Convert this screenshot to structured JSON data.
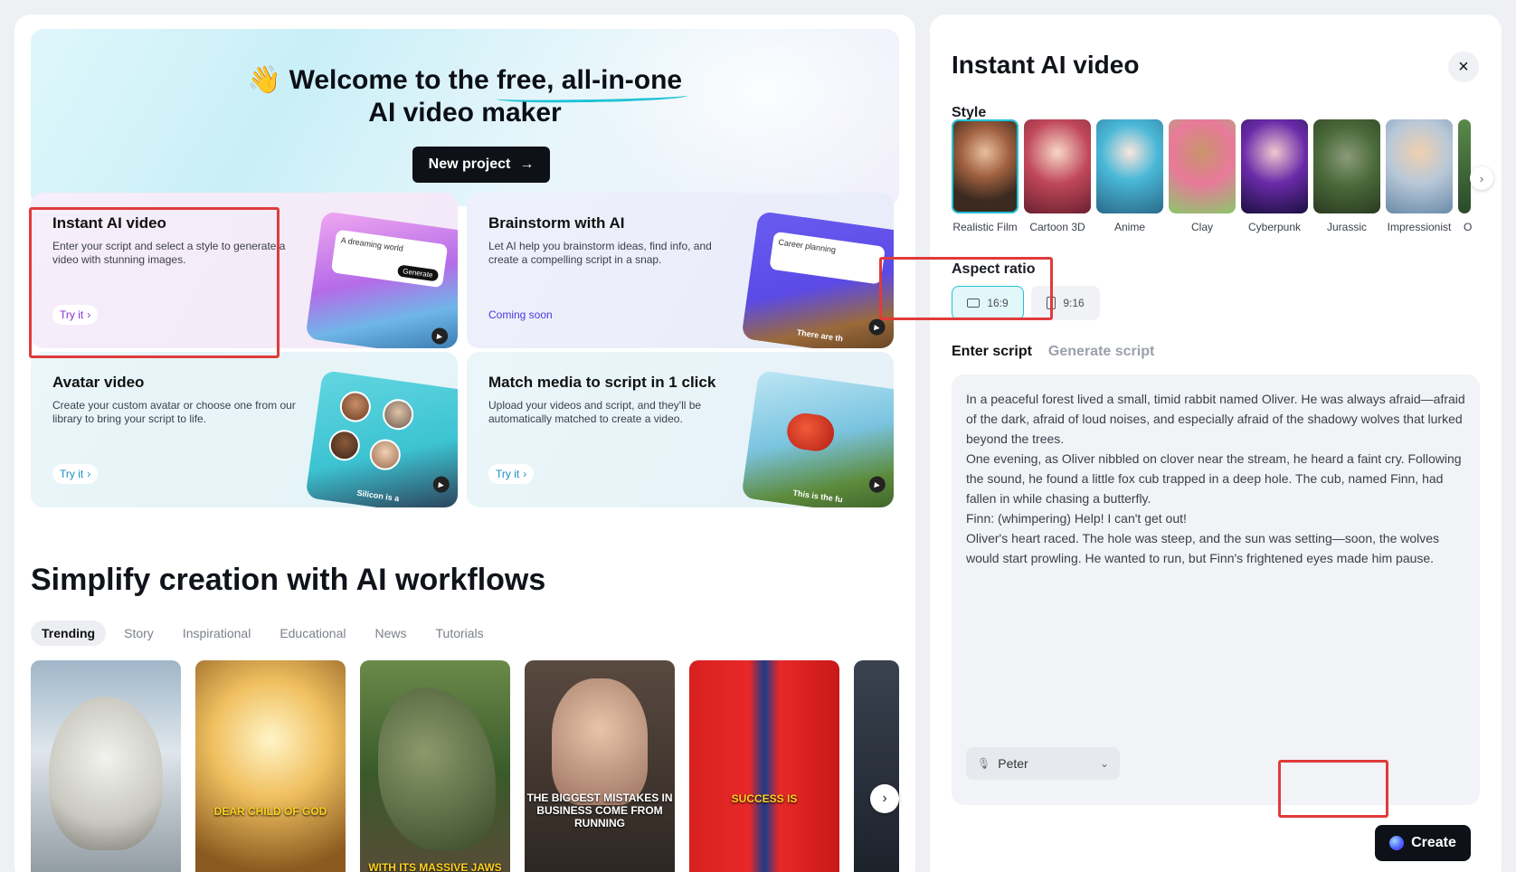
{
  "hero": {
    "emoji": "👋",
    "title_pre": "Welcome to the ",
    "title_highlight": "free, all-in-one",
    "title_line2": "AI video maker",
    "new_project_label": "New project",
    "arrow": "→"
  },
  "cards": [
    {
      "title": "Instant AI video",
      "desc": "Enter your script and select a style to generate a video with stunning images.",
      "cta": "Try it",
      "thumb_text": "A dreaming world",
      "thumb_btn": "Generate"
    },
    {
      "title": "Brainstorm with AI",
      "desc": "Let AI help you brainstorm ideas, find info, and create a compelling script in a snap.",
      "cta": "Coming soon",
      "thumb_text": "Career planning",
      "thumb_caption": "There are th"
    },
    {
      "title": "Avatar video",
      "desc": "Create your custom avatar or choose one from our library to bring your script to life.",
      "cta": "Try it",
      "thumb_caption": "Silicon is a"
    },
    {
      "title": "Match media to script in 1 click",
      "desc": "Upload your videos and script, and they'll be automatically matched to create a video.",
      "cta": "Try it",
      "thumb_caption": "This is the fu"
    }
  ],
  "workflows": {
    "title": "Simplify creation with AI workflows",
    "tabs": [
      "Trending",
      "Story",
      "Inspirational",
      "Educational",
      "News",
      "Tutorials"
    ],
    "active_tab": "Trending",
    "thumbnails": [
      {
        "caption": ""
      },
      {
        "caption": "DEAR CHILD OF GOD"
      },
      {
        "caption": "WITH ITS MASSIVE JAWS"
      },
      {
        "caption": "THE BIGGEST MISTAKES IN BUSINESS COME FROM RUNNING"
      },
      {
        "caption": "SUCCESS IS"
      }
    ]
  },
  "panel": {
    "title": "Instant AI video",
    "close_icon": "×",
    "style_label": "Style",
    "styles": [
      "Realistic Film",
      "Cartoon 3D",
      "Anime",
      "Clay",
      "Cyberpunk",
      "Jurassic",
      "Impressionist",
      "O"
    ],
    "selected_style": "Realistic Film",
    "aspect_label": "Aspect ratio",
    "aspect_options": [
      "16:9",
      "9:16"
    ],
    "selected_aspect": "16:9",
    "script_tabs": [
      "Enter script",
      "Generate script"
    ],
    "active_script_tab": "Enter script",
    "script_lines": [
      "In a peaceful forest lived a small, timid rabbit named Oliver. He was always afraid—afraid of the dark, afraid of loud noises, and especially afraid of the shadowy wolves that lurked beyond the trees.",
      "One evening, as Oliver nibbled on clover near the stream, he heard a faint cry. Following the sound, he found a little fox cub trapped in a deep hole. The cub, named Finn, had fallen in while chasing a butterfly.",
      "Finn: (whimpering) Help! I can't get out!",
      "Oliver's heart raced. The hole was steep, and the sun was setting—soon, the wolves would start prowling. He wanted to run, but Finn's frightened eyes made him pause."
    ],
    "voice": "Peter",
    "create_label": "Create"
  },
  "colors": {
    "accent": "#22c3d8",
    "highlight_box": "#e03b3b",
    "dark_button": "#0e1117"
  }
}
